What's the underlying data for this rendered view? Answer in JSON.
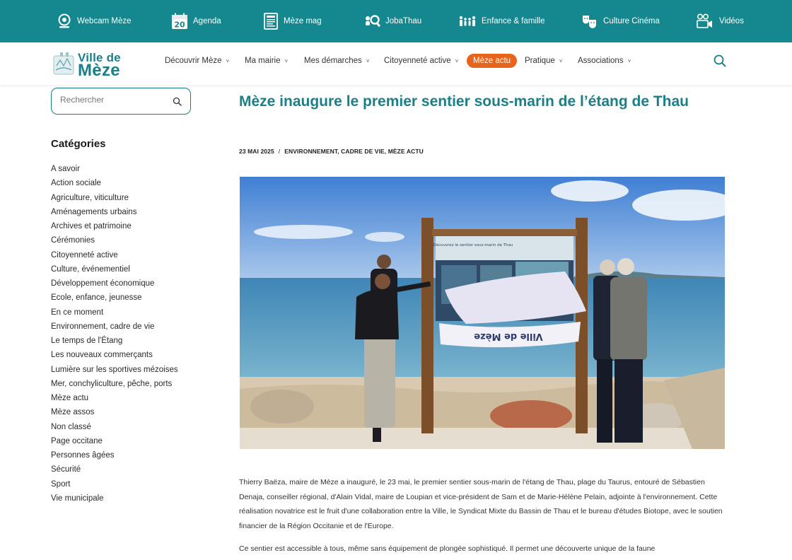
{
  "topbar": {
    "links": [
      {
        "label": "Webcam Mèze",
        "icon": "webcam-icon"
      },
      {
        "label": "Agenda",
        "icon": "calendar-icon",
        "badge": "20"
      },
      {
        "label": "Mèze mag",
        "icon": "magazine-icon"
      },
      {
        "label": "JobaThau",
        "icon": "jobathau-icon"
      },
      {
        "label": "Enfance & famille",
        "icon": "family-icon"
      },
      {
        "label": "Culture Cinéma",
        "icon": "culture-icon"
      },
      {
        "label": "Vidéos",
        "icon": "video-icon"
      }
    ]
  },
  "header": {
    "logo_line1": "Ville de",
    "logo_line2": "Mèze",
    "nav": [
      {
        "label": "Découvrir Mèze",
        "chevron": "˅"
      },
      {
        "label": "Ma mairie",
        "chevron": "˅"
      },
      {
        "label": "Mes démarches",
        "chevron": "˅"
      },
      {
        "label": "Citoyenneté active",
        "chevron": "˅"
      },
      {
        "label": "Mèze actu",
        "active": true
      },
      {
        "label": "Pratique",
        "chevron": "˅"
      },
      {
        "label": "Associations",
        "chevron": "˅"
      }
    ]
  },
  "sidebar": {
    "search_placeholder": "Rechercher",
    "categories_title": "Catégories",
    "categories": [
      "A savoir",
      "Action sociale",
      "Agriculture, viticulture",
      "Aménagements urbains",
      "Archives et patrimoine",
      "Cérémonies",
      "Citoyenneté active",
      "Culture, événementiel",
      "Développement économique",
      "Ecole, enfance, jeunesse",
      "En ce moment",
      "Environnement, cadre de vie",
      "Le temps de l'Étang",
      "Les nouveaux commerçants",
      "Lumière sur les sportives mézoises",
      "Mer, conchyliculture, pêche, ports",
      "Mèze actu",
      "Mèze assos",
      "Non classé",
      "Page occitane",
      "Personnes âgées",
      "Sécurité",
      "Sport",
      "Vie municipale"
    ]
  },
  "article": {
    "title": "Mèze inaugure le premier sentier sous-marin de l’étang de Thau",
    "date": "23 MAI 2025",
    "separator": "/",
    "categories": "ENVIRONNEMENT, CADRE DE VIE, MÈZE ACTU",
    "photo_banner_text": "Ville de Mèze",
    "panel_title": "Découvrez le sentier sous-marin de Thau",
    "paragraph1": "Thierry Baëza, maire de Mèze a inauguré, le 23 mai, le premier sentier sous-marin de l'étang de Thau, plage du Taurus, entouré de Sébastien Denaja, conseiller régional, d'Alain Vidal, maire de Loupian et vice-président de Sam et de Marie-Hélène Pelain, adjointe à l'environnement. Cette réalisation novatrice est le fruit d'une collaboration entre la Ville, le Syndicat Mixte du Bassin de Thau et le bureau d'études Biotope, avec le soutien financier de la Région Occitanie et de l'Europe.",
    "paragraph2": "Ce sentier est accessible à tous, même sans équipement de plongée sophistiqué. Il permet une découverte unique de la faune"
  },
  "colors": {
    "teal": "#15878f",
    "title_teal": "#1a7f89",
    "active_orange": "#e8631c"
  }
}
